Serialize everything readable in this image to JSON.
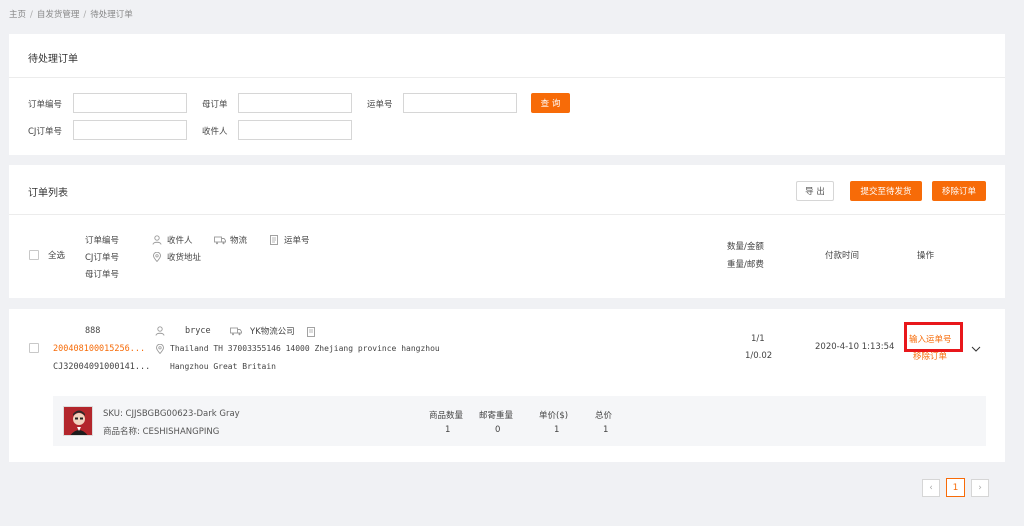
{
  "breadcrumb": {
    "home": "主页",
    "section": "自发货管理",
    "current": "待处理订单",
    "separator": "/"
  },
  "search_panel": {
    "title": "待处理订单",
    "fields": {
      "order_no": "订单编号",
      "parent_order": "母订单",
      "tracking_no": "运单号",
      "cj_order_no": "CJ订单号",
      "recipient": "收件人"
    },
    "query_button": "查 询"
  },
  "list_panel": {
    "title": "订单列表",
    "export_button": "导 出",
    "submit_button": "提交至待发货",
    "remove_button": "移除订单"
  },
  "table_header": {
    "select_all": "全选",
    "order_no": "订单编号",
    "cj_order_no": "CJ订单号",
    "parent_order": "母订单号",
    "recipient": "收件人",
    "logistics": "物流",
    "tracking_no": "运单号",
    "address": "收货地址",
    "qty_amount": "数量/金额",
    "weight_postage": "重量/邮费",
    "pay_time": "付款时间",
    "actions": "操作"
  },
  "order": {
    "order_no": "888",
    "parent_order_no": "200408100015256...",
    "cj_order_no": "CJ32004091000141...",
    "recipient": "bryce",
    "logistics": "YK物流公司",
    "address_line1": "Thailand TH 37003355146 14000 Zhejiang province hangzhou",
    "address_line2": "Hangzhou Great Britain",
    "qty_amount": "1/1",
    "weight_postage": "1/0.02",
    "pay_time": "2020-4-10 1:13:54",
    "action_input_tracking": "输入运单号",
    "action_remove": "移除订单"
  },
  "product": {
    "sku": "SKU: CJJSBGBG00623-Dark Gray",
    "name": "商品名称: CESHISHANGPING",
    "qty_label": "商品数量",
    "qty_value": "1",
    "weight_label": "邮寄重量",
    "weight_value": "0",
    "price_label": "单价($)",
    "price_value": "1",
    "total_label": "总价",
    "total_value": "1"
  },
  "pagination": {
    "prev": "‹",
    "current_page": "1",
    "next": "›"
  },
  "colors": {
    "accent": "#f76b08",
    "highlight_box": "#e8171b"
  },
  "icons": [
    "user-icon",
    "truck-icon",
    "document-icon",
    "location-pin-icon",
    "chevron-down-icon"
  ]
}
